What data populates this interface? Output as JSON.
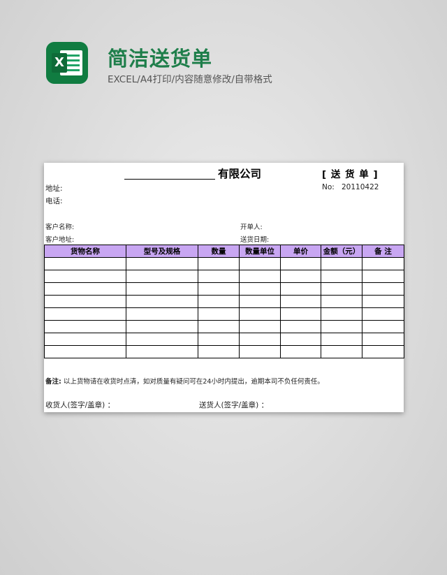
{
  "header": {
    "icon": "excel-icon",
    "icon_letter": "X",
    "title": "简洁送货单",
    "subtitle": "EXCEL/A4打印/内容随意修改/自带格式"
  },
  "form": {
    "company_suffix": "有限公司",
    "doc_type": "[ 送 货 单 ]",
    "address_label": "地址:",
    "phone_label": "电话:",
    "no_label": "No:",
    "no_value": "20110422",
    "customer_name_label": "客户名称:",
    "customer_address_label": "客户地址:",
    "issuer_label": "开单人:",
    "delivery_date_label": "送货日期:",
    "columns": [
      "货物名称",
      "型号及规格",
      "数量",
      "数量单位",
      "单价",
      "金额（元）",
      "备 注"
    ],
    "empty_row_count": 8,
    "note_label": "备注:",
    "note_text": "以上货物请在收货时点清，如对质量有疑问可在24小时内提出，逾期本司不负任何责任。",
    "receiver_sign": "收货人(签字/盖章) ：",
    "sender_sign": "送货人(签字/盖章) ："
  },
  "colors": {
    "brand_green": "#1e7e4a",
    "header_purple": "#c8a6f2"
  }
}
